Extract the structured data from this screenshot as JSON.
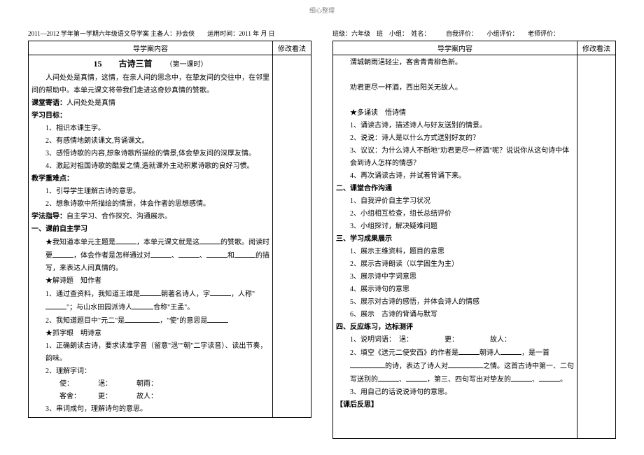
{
  "header_center": "细心整理",
  "left_meta": "2011—2012 学年第一学期六年级语文导学案  主备人：孙会侠　　运用时间：2011 年 月 日",
  "right_meta": "班级：六年级　班　小组：　姓名：　　　自我评价：　　小组评价：　　老师评价：",
  "th_content": "导学案内容",
  "th_edit": "修改看法",
  "lesson_no": "15",
  "lesson_title": "古诗三首",
  "lesson_sub": "（第一课时）",
  "intro": "人间处处是真情，这情，在亲人间的思念中，在挚友间的交往中，在邻里间的帮助中。本单元课文将带我们走进这奇妙真情的赞歌。",
  "l1": "课堂寄语：",
  "l1v": "人间处处是真情",
  "l2": "学习目标：",
  "l2a": "1、相识本课生字。",
  "l2b": "2、有感情地朗读课文,背诵课文。",
  "l2c": "3、感悟诗歌的内容,想象诗歌所描绘的情景,体会挚友间的深厚友情。",
  "l2d": "4、激起对祖国诗歌的酷爱之情,造就课外主动积累诗歌的良好习惯。",
  "l3": "教学重难点：",
  "l3a": "1、引导学生理解古诗的意思。",
  "l3b": "2、想象诗歌中所描绘的情景，体会作者的思想感情。",
  "l4": "学法指导：",
  "l4v": "自主学习、合作探究、沟通展示。",
  "s1": "一、课前自主学习",
  "s1a_pre": "★我知道本单元主题是",
  "s1a_mid": "，本单元课文就是这",
  "s1a_end": "的赞歌。阅读时要",
  "s1a_2": "，体会作者是怎样通过对",
  "s1a_3": "的描写，来表达人间真情的。",
  "s1b": "★解诗题　知作者",
  "s1b1_pre": "1、通过查资料，我知道王维是",
  "s1b1_mid": "朝著名诗人，字",
  "s1b1_mid2": "，人称\"",
  "s1b1_end": "\"；与山水田园派诗人",
  "s1b1_end2": "合称\"王孟\"。",
  "s1b2_pre": "2、我知道题目中\"元二\"是",
  "s1b2_mid": "，\"使\"的意思是",
  "s1c": "★抓字眼　明诗意",
  "s1c1": "1、正确朗读古诗，要求读准字音（留意\"浥\"\"朝\"二字读音）、读出节奏，韵味。",
  "s1c2": "2、理解字词：",
  "w1": "使：",
  "w2": "浥：",
  "w3": "朝雨：",
  "w4": "客舍：",
  "w5": "更：",
  "w6": "故人：",
  "s1c3": "3、串词成句，理解诗句的意思。",
  "r_poem1": "渭城朝雨浥轻尘，客舍青青柳色新。",
  "r_poem2": "劝君更尽一杯酒，西出阳关无故人。",
  "r_s1": "★多诵读　悟诗情",
  "r_s1a": "1、诵读古诗，描述诗人与好友送别的情景。",
  "r_s1b": "2、说说：诗人是以什么方式送别好友的？",
  "r_s1c": "3、议议：为什么诗人不断地\"劝君更尽一杯酒\"呢？说说你从这句诗中体会到诗人怎样的情感？",
  "r_s1d": "4、再次诵读古诗，并试着背诵下来。",
  "r_s2": "二、课堂合作沟通",
  "r_s2a": "1、自我评价自主学习状况",
  "r_s2b": "2、小组相互检查，组长总结评价",
  "r_s2c": "3、小组探讨，解决疑难问题",
  "r_s3": "三、学习成果展示",
  "r_s3a": "1、展示王维资料，题目的意思",
  "r_s3b": "2、展示古诗朗读（以学困生为主）",
  "r_s3c": "3、展示诗中字词意思",
  "r_s3d": "4、展示诗句的意思",
  "r_s3e": "5、展示对古诗的感悟，并体会诗人的情感",
  "r_s3f": "6、展示　古诗的背诵与默写",
  "r_s4": "四、反应练习，达标测评",
  "r_s4a": "1、说明词语：　浥：　　　　　更：　　　　　故人：",
  "r_s4b_pre": "2、填空《送元二使安西》的作者是",
  "r_s4b_mid": "朝诗人",
  "r_s4b_mid2": "，是一首",
  "r_s4b_mid3": "的诗，表达了诗人对",
  "r_s4b_mid4": "之情。这首古诗中第一、二句写送别的",
  "r_s4b_mid5": "，第三、四句写出对挚友的",
  "r_s4c": "3、用自己的话说说诗句的意思。",
  "r_reflect": "【课后反思】"
}
